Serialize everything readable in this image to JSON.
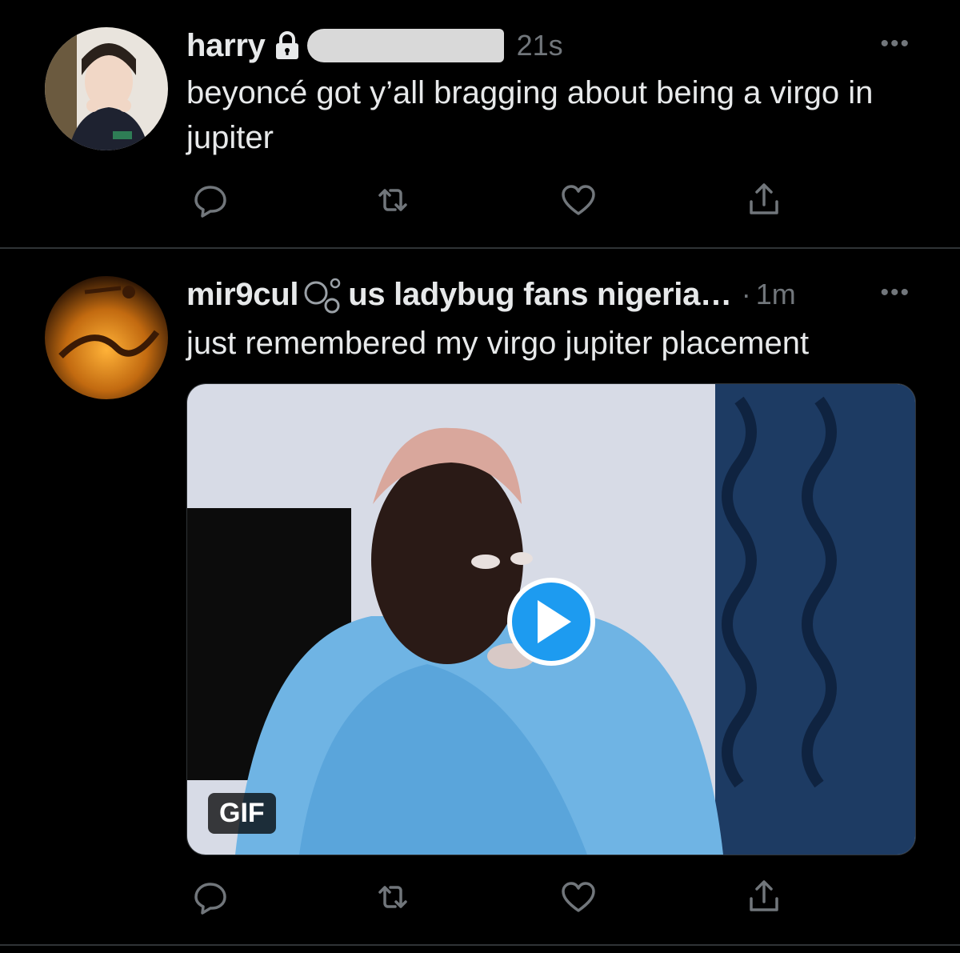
{
  "tweets": [
    {
      "name": "harry",
      "time": "21s",
      "more": "•••",
      "text": "beyoncé got y’all bragging about being a virgo in jupiter"
    },
    {
      "name": "mir9cul",
      "name_suffix": "us ladybug fans nigeria…",
      "separator": "·",
      "time": "1m",
      "more": "•••",
      "text": "just remembered my virgo jupiter placement",
      "media": {
        "badge": "GIF"
      }
    }
  ],
  "icons": [
    "reply-icon",
    "retweet-icon",
    "like-icon",
    "share-icon",
    "lock-icon",
    "play-icon",
    "bubbles-icon"
  ],
  "colors": {
    "background": "#000000",
    "text": "#e7e9ea",
    "secondary": "#71767b",
    "accent": "#1d9bf0",
    "divider": "#2f3336"
  }
}
